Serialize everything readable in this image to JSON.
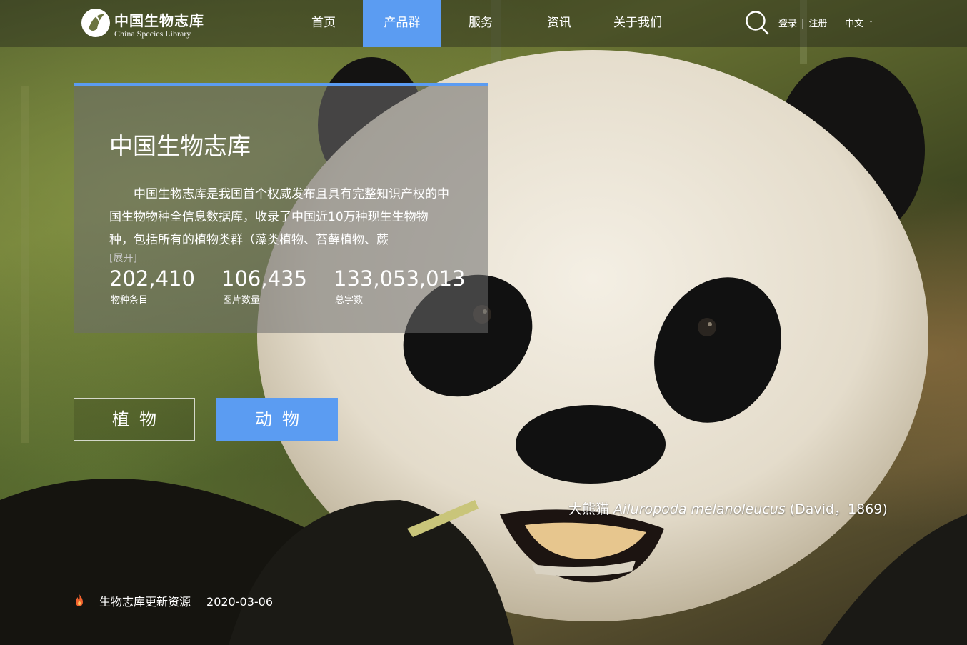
{
  "site": {
    "logo_cn": "中国生物志库",
    "logo_en": "China Species Library"
  },
  "nav": {
    "items": [
      {
        "label": "首页",
        "active": false
      },
      {
        "label": "产品群",
        "active": true
      },
      {
        "label": "服务",
        "active": false
      },
      {
        "label": "资讯",
        "active": false
      },
      {
        "label": "关于我们",
        "active": false
      }
    ],
    "accent": "#5b9cf2"
  },
  "header": {
    "search_icon": "search-icon",
    "login": "登录",
    "separator": "|",
    "register": "注册",
    "language": "中文"
  },
  "intro": {
    "title": "中国生物志库",
    "description": "中国生物志库是我国首个权威发布且具有完整知识产权的中国生物物种全信息数据库，收录了中国近10万种现生生物物种，包括所有的植物类群（藻类植物、苔藓植物、蕨",
    "expand": "[展开]",
    "stats": [
      {
        "value": "202,410",
        "label": "物种条目"
      },
      {
        "value": "106,435",
        "label": "图片数量"
      },
      {
        "value": "133,053,013",
        "label": "总字数"
      }
    ]
  },
  "categories": {
    "plant": "植物",
    "animal": "动物"
  },
  "caption": {
    "common_name": "大熊猫",
    "scientific_name": "Ailuropoda melanoleucus",
    "author": "(David，1869)"
  },
  "news": {
    "icon": "fire-icon",
    "title": "生物志库更新资源",
    "date": "2020-03-06"
  }
}
